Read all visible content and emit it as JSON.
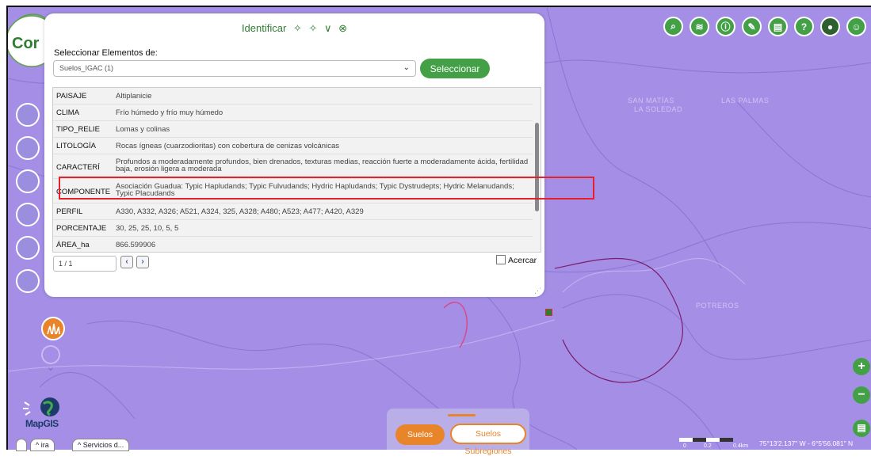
{
  "dialog": {
    "title": "Identificar",
    "select_label": "Seleccionar Elementos de:",
    "select_value": "Suelos_IGAC (1)",
    "select_button": "Seleccionar",
    "rows": [
      {
        "key": "PAISAJE",
        "value": "Altiplanicie"
      },
      {
        "key": "CLIMA",
        "value": "Frío húmedo y frío muy húmedo"
      },
      {
        "key": "TIPO_RELIE",
        "value": "Lomas y colinas"
      },
      {
        "key": "LITOLOGÍA",
        "value": "Rocas ígneas (cuarzodioritas) con cobertura de cenizas volcánicas"
      },
      {
        "key": "CARACTERÍ",
        "value": "Profundos a moderadamente profundos, bien drenados, texturas medias, reacción fuerte a moderadamente ácida, fertilidad baja, erosión ligera a moderada"
      },
      {
        "key": "COMPONENTE",
        "value": "Asociación Guadua: Typic Hapludands; Typic Fulvudands; Hydric Hapludands; Typic Dystrudepts; Hydric Melanudands; Typic Placudands"
      },
      {
        "key": "PERFIL",
        "value": "A330, A332, A326; A521, A324, 325, A328; A480; A523; A477; A420, A329"
      },
      {
        "key": "PORCENTAJE",
        "value": "30, 25, 25, 10, 5, 5"
      },
      {
        "key": "ÁREA_ha",
        "value": "866.599906"
      }
    ],
    "pager": "1 / 1",
    "zoom_label": "Acercar"
  },
  "map": {
    "labels": {
      "san_matias": "SAN MATÍAS",
      "la_soledad": "LA SOLEDAD",
      "las_palmas": "LAS PALMAS",
      "potreros": "POTREROS"
    },
    "logo_text": "Cor",
    "mapgis": "MapGIS",
    "layer_tab_active": "Suelos",
    "layer_tab_other": "Suelos Subregiones",
    "chip_1": "^ ira",
    "chip_2": "^ Servicios d...",
    "scale_0": "0",
    "scale_1": "0.2",
    "scale_2": "0.4km",
    "coords": "75°13'2.137\" W - 6°5'56.081\" N"
  },
  "toolbar": {
    "icons": [
      "search-icon",
      "layers-icon",
      "info-icon",
      "brush-icon",
      "briefcase-icon",
      "help-icon",
      "user-photo-icon",
      "account-icon"
    ]
  }
}
